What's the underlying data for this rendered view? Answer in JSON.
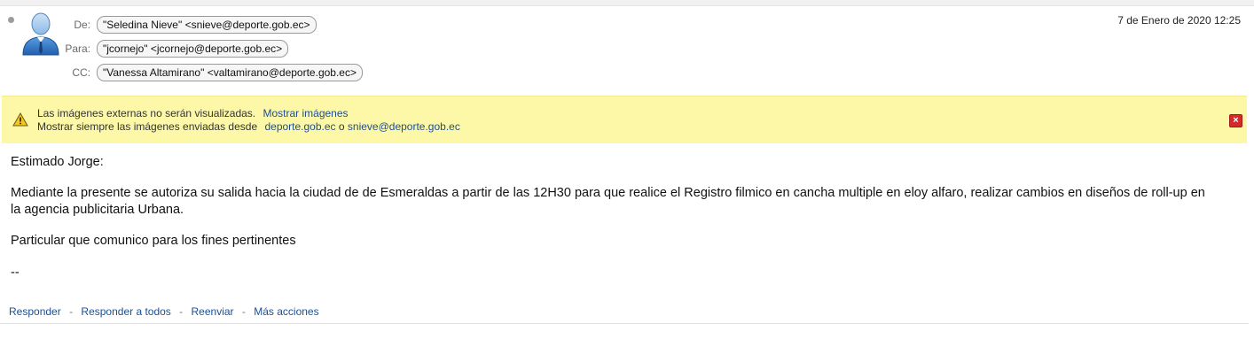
{
  "header": {
    "from_label": "De:",
    "from_value": "\"Seledina Nieve\" <snieve@deporte.gob.ec>",
    "to_label": "Para:",
    "to_value": "\"jcornejo\" <jcornejo@deporte.gob.ec>",
    "cc_label": "CC:",
    "cc_value": "\"Vanessa Altamirano\" <valtamirano@deporte.gob.ec>",
    "date": "7 de Enero de 2020 12:25"
  },
  "banner": {
    "line1_text": "Las imágenes externas no serán visualizadas.",
    "show_images_link": "Mostrar imágenes",
    "line2_text": "Mostrar siempre las imágenes enviadas desde",
    "domain_link": "deporte.gob.ec",
    "or_text": "o",
    "sender_link": "snieve@deporte.gob.ec",
    "close_symbol": "×"
  },
  "message": {
    "greeting": "Estimado Jorge:",
    "paragraph": "Mediante la presente se autoriza su salida hacia la ciudad de de Esmeraldas a partir de las 12H30 para que realice el Registro filmico en cancha multiple en eloy alfaro, realizar cambios en diseños de roll-up en la agencia publicitaria Urbana.",
    "closing": "Particular que comunico para los fines pertinentes",
    "signature_sep": "--"
  },
  "actions": {
    "reply": "Responder",
    "reply_all": "Responder a todos",
    "forward": "Reenviar",
    "more": "Más acciones",
    "separator": "-"
  },
  "icons": {
    "unread_dot": "status-dot-icon",
    "avatar": "user-avatar-icon",
    "warning": "warning-icon",
    "close": "close-icon"
  },
  "colors": {
    "banner_bg": "#fcf8a8",
    "link": "#1d4f91",
    "close": "#d32b2b"
  }
}
